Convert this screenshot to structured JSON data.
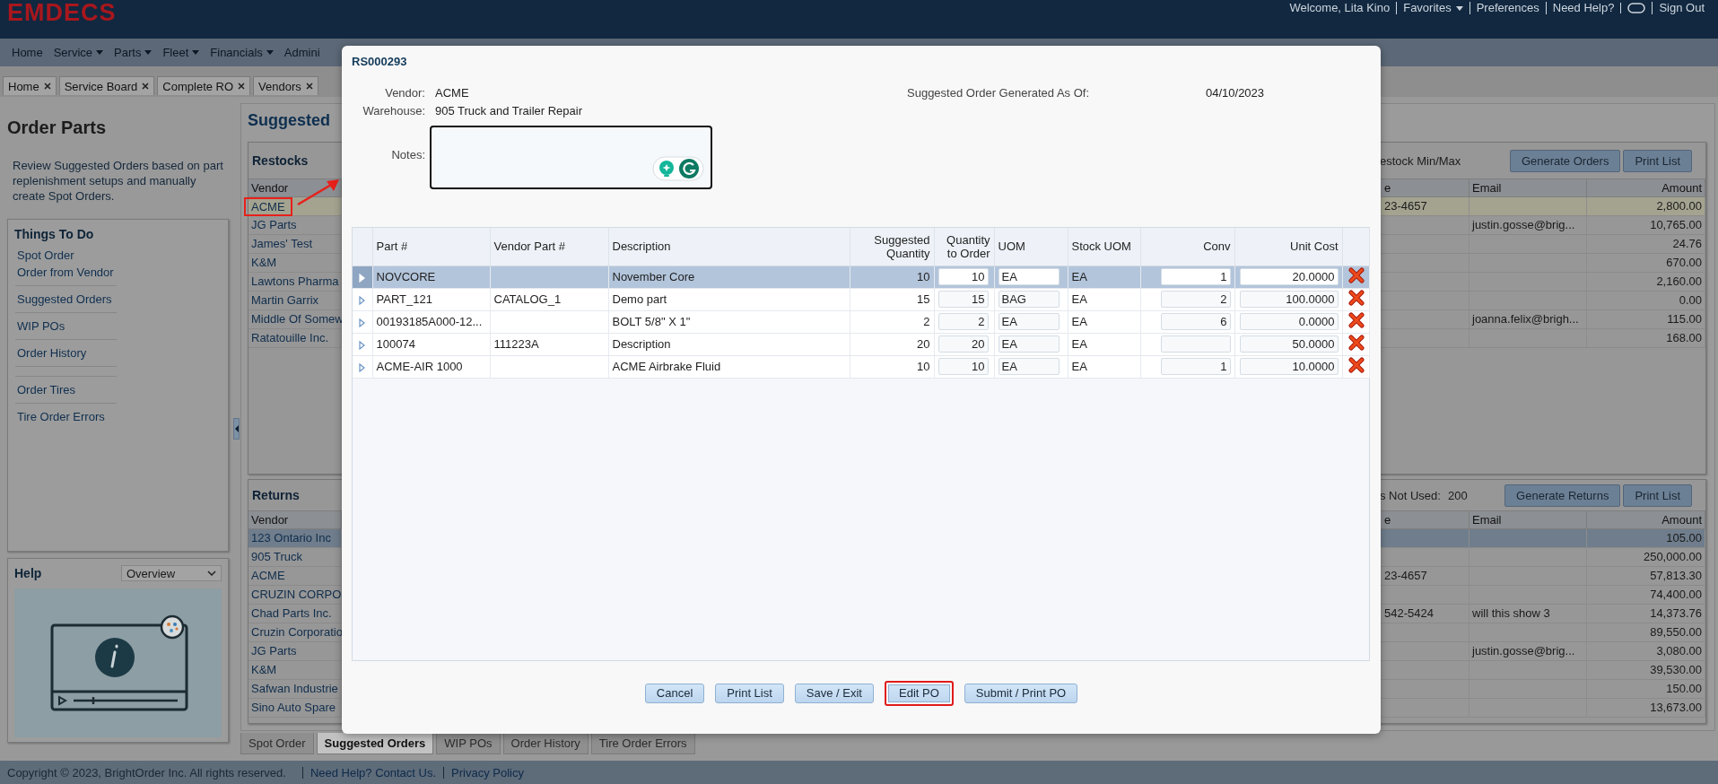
{
  "header": {
    "logo": "EMDECS",
    "welcome": "Welcome, Lita Kino",
    "links": [
      {
        "kind": "dropdown",
        "label": "Favorites"
      },
      {
        "kind": "link",
        "label": "Preferences"
      },
      {
        "kind": "link",
        "label": "Need Help?"
      },
      {
        "kind": "chat"
      },
      {
        "kind": "link",
        "label": "Sign Out"
      }
    ]
  },
  "menu": [
    {
      "label": "Home",
      "dropdown": false
    },
    {
      "label": "Service",
      "dropdown": true
    },
    {
      "label": "Parts",
      "dropdown": true
    },
    {
      "label": "Fleet",
      "dropdown": true
    },
    {
      "label": "Financials",
      "dropdown": true
    },
    {
      "label": "Admini",
      "dropdown": false
    }
  ],
  "open_tabs": [
    {
      "label": "Home"
    },
    {
      "label": "Service Board"
    },
    {
      "label": "Complete RO"
    },
    {
      "label": "Vendors"
    }
  ],
  "sidebar": {
    "title": "Order Parts",
    "description": "Review Suggested Orders based on part replenishment setups and manually create Spot Orders.",
    "todo": {
      "title": "Things To Do",
      "items": [
        {
          "kind": "link",
          "label": "Spot Order"
        },
        {
          "kind": "link",
          "label": "Order from Vendor"
        },
        {
          "kind": "separator"
        },
        {
          "kind": "link",
          "label": "Suggested Orders"
        },
        {
          "kind": "separator"
        },
        {
          "kind": "link",
          "label": "WIP POs"
        },
        {
          "kind": "separator"
        },
        {
          "kind": "link",
          "label": "Order History"
        },
        {
          "kind": "separator"
        },
        {
          "kind": "separator"
        },
        {
          "kind": "link",
          "label": "Order Tires"
        },
        {
          "kind": "separator"
        },
        {
          "kind": "link",
          "label": "Tire Order Errors"
        }
      ]
    },
    "help": {
      "title": "Help",
      "select": "Overview"
    }
  },
  "main": {
    "title": "Suggested",
    "restocks": {
      "title": "Restocks",
      "info_label": "estock Min/Max",
      "buttons": [
        "Generate Orders",
        "Print List"
      ],
      "columns": [
        "Vendor",
        "e",
        "Email",
        "Amount"
      ],
      "rows": [
        {
          "vendor": "ACME",
          "column_3": "23-4657",
          "amount": "2,800.00",
          "selected": true,
          "highlighted": true
        },
        {
          "vendor": "JG Parts",
          "email": "justin.gosse@brig...",
          "amount": "10,765.00",
          "selected": false,
          "highlighted": false
        },
        {
          "vendor": "James' Test",
          "amount": "24.76",
          "selected": false,
          "highlighted": false
        },
        {
          "vendor": "K&M",
          "amount": "670.00",
          "selected": false,
          "highlighted": false
        },
        {
          "vendor": "Lawtons Pharma",
          "amount": "2,160.00",
          "selected": false,
          "highlighted": false
        },
        {
          "vendor": "Martin Garrix",
          "amount": "0.00",
          "selected": false,
          "highlighted": false
        },
        {
          "vendor": "Middle Of Somew",
          "email": "joanna.felix@brigh...",
          "amount": "115.00",
          "selected": false,
          "highlighted": false
        },
        {
          "vendor": "Ratatouille Inc.",
          "amount": "168.00",
          "selected": false,
          "highlighted": false
        }
      ]
    },
    "returns": {
      "title": "Returns",
      "info_label": "s Not Used:",
      "info_value": "200",
      "buttons": [
        "Generate Returns",
        "Print List"
      ],
      "columns": [
        "Vendor",
        "e",
        "Email",
        "Amount"
      ],
      "rows": [
        {
          "vendor": "123 Ontario Inc",
          "amount": "105.00",
          "selected": true,
          "highlighted": false
        },
        {
          "vendor": "905 Truck",
          "amount": "250,000.00",
          "selected": false,
          "highlighted": false
        },
        {
          "vendor": "ACME",
          "column_3": "23-4657",
          "amount": "57,813.30",
          "selected": false,
          "highlighted": false
        },
        {
          "vendor": "CRUZIN CORPO",
          "amount": "74,400.00",
          "selected": false,
          "highlighted": false
        },
        {
          "vendor": "Chad Parts Inc.",
          "column_3": "542-5424",
          "email": "will this show 3",
          "amount": "14,373.76",
          "selected": false,
          "highlighted": false
        },
        {
          "vendor": "Cruzin Corporatio",
          "amount": "89,550.00",
          "selected": false,
          "highlighted": false
        },
        {
          "vendor": "JG Parts",
          "email": "justin.gosse@brig...",
          "amount": "3,080.00",
          "selected": false,
          "highlighted": false
        },
        {
          "vendor": "K&M",
          "amount": "39,530.00",
          "selected": false,
          "highlighted": false
        },
        {
          "vendor": "Safwan Industrie",
          "amount": "150.00",
          "selected": false,
          "highlighted": false
        },
        {
          "vendor": "Sino Auto Spare",
          "amount": "13,673.00",
          "selected": false,
          "highlighted": false
        }
      ]
    }
  },
  "bottom_tabs": [
    {
      "label": "Spot Order",
      "selected": false
    },
    {
      "label": "Suggested Orders",
      "selected": true
    },
    {
      "label": "WIP POs",
      "selected": false
    },
    {
      "label": "Order History",
      "selected": false
    },
    {
      "label": "Tire Order Errors",
      "selected": false
    }
  ],
  "footer": {
    "copyright": "Copyright © 2023, BrightOrder Inc. All rights reserved.",
    "links": [
      "Need Help? Contact Us.",
      "Privacy Policy"
    ]
  },
  "dialog": {
    "title": "RS000293",
    "fields": [
      {
        "label": "Vendor:",
        "value": "ACME"
      },
      {
        "label": "Warehouse:",
        "value": "905 Truck and Trailer Repair"
      }
    ],
    "generated": {
      "label": "Suggested Order Generated As Of:",
      "value": "04/10/2023"
    },
    "notes": {
      "label": "Notes:"
    },
    "table": {
      "columns": [
        "Part #",
        "Vendor Part #",
        "Description",
        "Suggested Quantity",
        "Quantity to Order",
        "UOM",
        "Stock UOM",
        "Conv",
        "Unit Cost"
      ],
      "rows": [
        {
          "part": "NOVCORE",
          "description": "November Core",
          "suggested": "10",
          "quantity": "10",
          "uom": "EA",
          "stock_uom": "EA",
          "conv": "1",
          "unit_cost": "20.0000",
          "selected": true
        },
        {
          "part": "PART_121",
          "vendor_part": "CATALOG_1",
          "description": "Demo part",
          "suggested": "15",
          "quantity": "15",
          "uom": "BAG",
          "stock_uom": "EA",
          "conv": "2",
          "unit_cost": "100.0000",
          "selected": false
        },
        {
          "part": "00193185A000-12...",
          "description": "BOLT 5/8\" X 1\"",
          "suggested": "2",
          "quantity": "2",
          "uom": "EA",
          "stock_uom": "EA",
          "conv": "6",
          "unit_cost": "0.0000",
          "selected": false
        },
        {
          "part": "100074",
          "vendor_part": "111223A",
          "description": "Description",
          "suggested": "20",
          "quantity": "20",
          "uom": "EA",
          "stock_uom": "EA",
          "unit_cost": "50.0000",
          "selected": false
        },
        {
          "part": "ACME-AIR 1000",
          "description": "ACME Airbrake Fluid",
          "suggested": "10",
          "quantity": "10",
          "uom": "EA",
          "stock_uom": "EA",
          "conv": "1",
          "unit_cost": "10.0000",
          "selected": false
        }
      ]
    },
    "buttons": [
      {
        "label": "Cancel",
        "highlighted": false
      },
      {
        "label": "Print List",
        "highlighted": false
      },
      {
        "label": "Save / Exit",
        "highlighted": false
      },
      {
        "label": "Edit PO",
        "highlighted": true
      },
      {
        "label": "Submit / Print PO",
        "highlighted": false
      }
    ]
  }
}
